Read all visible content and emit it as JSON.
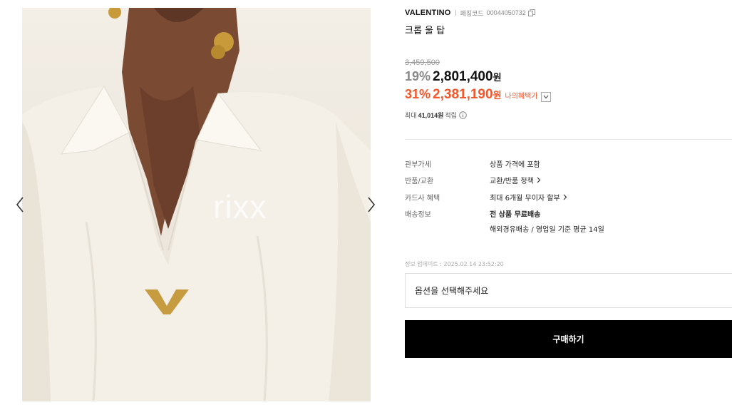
{
  "gallery": {
    "watermark": "rixx",
    "prev_icon": "chevron-left-icon",
    "next_icon": "chevron-right-icon"
  },
  "product": {
    "brand": "VALENTINO",
    "code_label": "페칭코드",
    "code_value": "00044050732",
    "copy_icon": "copy-icon",
    "name": "크롭 울 탑"
  },
  "pricing": {
    "original": "3,459,500",
    "sale_percent": "19%",
    "sale_price": "2,801,400",
    "sale_unit": "원",
    "benefit_percent": "31%",
    "benefit_price": "2,381,190",
    "benefit_unit": "원",
    "benefit_label": "나의혜택가",
    "points_prefix": "최대",
    "points_value": "41,014원",
    "points_suffix": "적립",
    "accent_color": "#f5562a"
  },
  "specs": [
    {
      "label": "관부가세",
      "value": "상품 가격에 포함"
    },
    {
      "label": "반품/교환",
      "value": "교환/반품 정책"
    },
    {
      "label": "카드사 혜택",
      "value": "최대 6개월 무이자 할부"
    },
    {
      "label": "배송정보",
      "value": "전 상품 무료배송",
      "value2": "해외경유배송 / 영업일 기준 평균 14일"
    }
  ],
  "update_info": "정보 업데이트 : 2025.02.14 23:52:20",
  "option_placeholder": "옵션을 선택해주세요",
  "buy_label": "구매하기"
}
